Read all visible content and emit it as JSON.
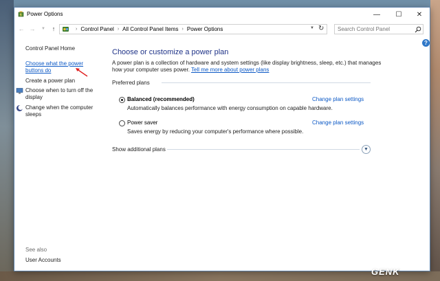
{
  "window": {
    "title": "Power Options"
  },
  "controls": {
    "minimize": "—",
    "maximize": "☐",
    "close": "✕"
  },
  "address": {
    "crumbs": [
      "Control Panel",
      "All Control Panel Items",
      "Power Options"
    ],
    "separator": "›"
  },
  "search": {
    "placeholder": "Search Control Panel"
  },
  "sidebar": {
    "home": "Control Panel Home",
    "items": [
      {
        "label": "Choose what the power buttons do",
        "icon": "none"
      },
      {
        "label": "Create a power plan",
        "icon": "none"
      },
      {
        "label": "Choose when to turn off the display",
        "icon": "monitor-icon"
      },
      {
        "label": "Change when the computer sleeps",
        "icon": "moon-icon"
      }
    ],
    "see_also": "See also",
    "user_accounts": "User Accounts"
  },
  "main": {
    "title": "Choose or customize a power plan",
    "description": "A power plan is a collection of hardware and system settings (like display brightness, sleep, etc.) that manages how your computer uses power.",
    "tell_me_more": "Tell me more about power plans",
    "preferred_label": "Preferred plans",
    "plans": [
      {
        "name": "Balanced (recommended)",
        "description": "Automatically balances performance with energy consumption on capable hardware.",
        "link": "Change plan settings",
        "selected": true
      },
      {
        "name": "Power saver",
        "description": "Saves energy by reducing your computer's performance where possible.",
        "link": "Change plan settings",
        "selected": false
      }
    ],
    "show_additional": "Show additional plans"
  },
  "help": "?",
  "watermark": "GENK",
  "colors": {
    "link": "#0b58c5",
    "title": "#1e3287",
    "accent_arrow": "#e02020"
  }
}
